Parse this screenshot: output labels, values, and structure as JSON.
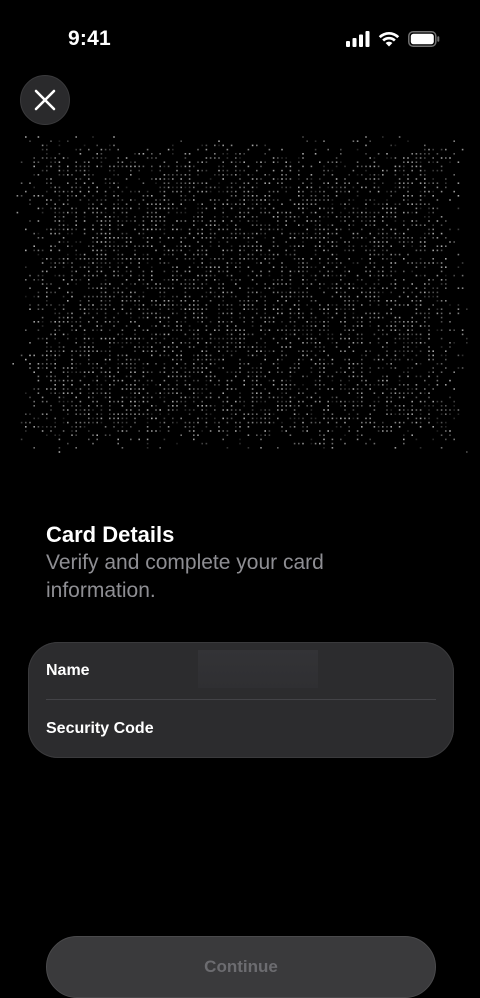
{
  "status_bar": {
    "time": "9:41",
    "icons": [
      "signal-icon",
      "wifi-icon",
      "battery-icon"
    ]
  },
  "close_button": {
    "icon": "close-icon"
  },
  "card_visual": {
    "icon": "dotted-card-placeholder"
  },
  "details": {
    "title": "Card Details",
    "subtitle": "Verify and complete your card information."
  },
  "form": {
    "name_label": "Name",
    "security_code_label": "Security Code"
  },
  "continue_button": {
    "label": "Continue",
    "enabled": false
  },
  "colors": {
    "background": "#000000",
    "surface": "#2c2c2e",
    "secondary_text": "#8e8e93",
    "disabled_text": "#6c6c70"
  }
}
